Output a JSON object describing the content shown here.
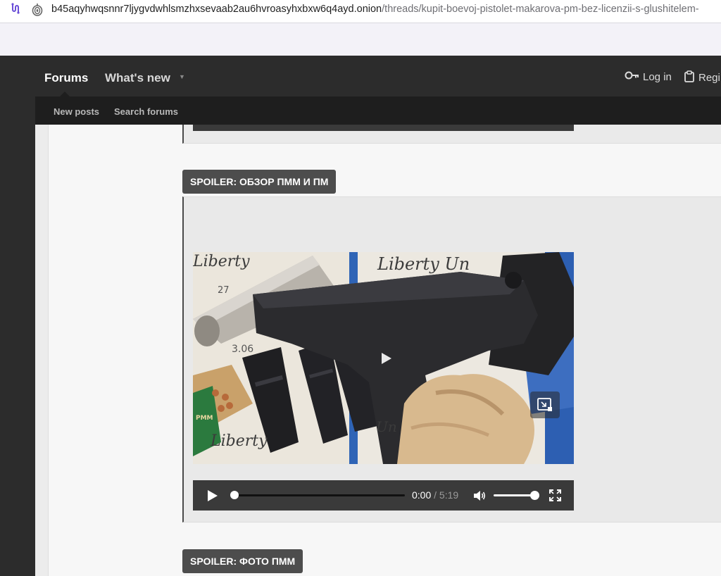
{
  "browser": {
    "url_host": "b45aqyhwqsnnr7ljygvdwhlsmzhxsevaab2au6hvroasyhxbxw6q4ayd.onion",
    "url_path": "/threads/kupit-boevoj-pistolet-makarova-pm-bez-licenzii-s-glushitelem-"
  },
  "header": {
    "nav": {
      "forums": "Forums",
      "whats_new": "What's new",
      "login": "Log in",
      "register": "Regi"
    },
    "subnav": {
      "new_posts": "New posts",
      "search_forums": "Search forums"
    }
  },
  "spoilers": {
    "review": "SPOILER: ОБЗОР ПММ И ПМ",
    "photo": "SPOILER: ФОТО ПММ"
  },
  "video": {
    "overlay_text_1": "Liberty",
    "overlay_text_2": "Liberty Un",
    "overlay_text_3": "Liberty",
    "overlay_text_4": "Un",
    "overlay_text_5": "3.06",
    "overlay_text_6": "27",
    "box_label": "PMM",
    "current_time": "0:00",
    "separator": " / ",
    "duration": "5:19",
    "progress": 0,
    "volume": 1
  },
  "icons": {
    "addr_left": "link-icon",
    "addr_secure": "onion-icon",
    "login": "key-icon",
    "register": "clipboard-icon",
    "play": "play-icon",
    "volume": "volume-icon",
    "fullscreen": "fullscreen-icon",
    "pip": "picture-in-picture-icon"
  }
}
